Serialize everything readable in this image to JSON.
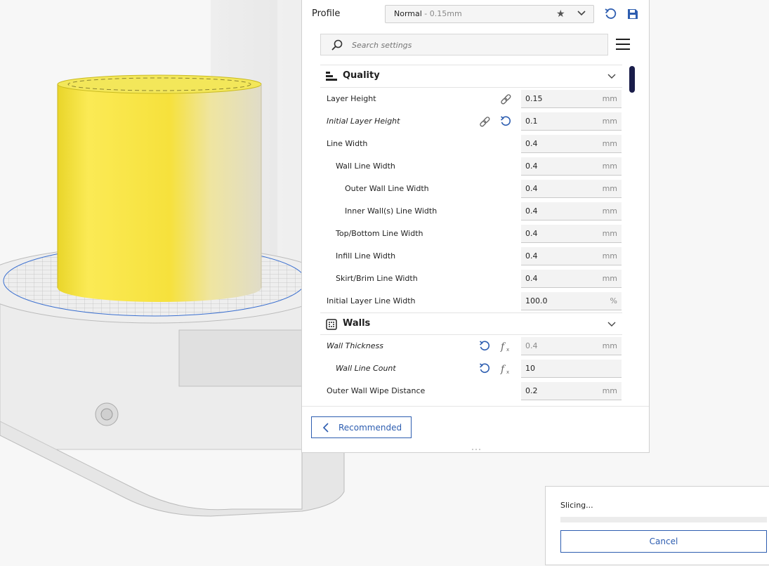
{
  "profile": {
    "label": "Profile",
    "selected_name": "Normal",
    "selected_layer": " - 0.15mm"
  },
  "search": {
    "placeholder": "Search settings"
  },
  "categories": {
    "quality": {
      "title": "Quality",
      "rows": [
        {
          "label": "Layer Height",
          "value": "0.15",
          "unit": "mm"
        },
        {
          "label": "Initial Layer Height",
          "value": "0.1",
          "unit": "mm"
        },
        {
          "label": "Line Width",
          "value": "0.4",
          "unit": "mm"
        },
        {
          "label": "Wall Line Width",
          "value": "0.4",
          "unit": "mm"
        },
        {
          "label": "Outer Wall Line Width",
          "value": "0.4",
          "unit": "mm"
        },
        {
          "label": "Inner Wall(s) Line Width",
          "value": "0.4",
          "unit": "mm"
        },
        {
          "label": "Top/Bottom Line Width",
          "value": "0.4",
          "unit": "mm"
        },
        {
          "label": "Infill Line Width",
          "value": "0.4",
          "unit": "mm"
        },
        {
          "label": "Skirt/Brim Line Width",
          "value": "0.4",
          "unit": "mm"
        },
        {
          "label": "Initial Layer Line Width",
          "value": "100.0",
          "unit": "%"
        }
      ]
    },
    "walls": {
      "title": "Walls",
      "rows": [
        {
          "label": "Wall Thickness",
          "value": "0.4",
          "unit": "mm"
        },
        {
          "label": "Wall Line Count",
          "value": "10",
          "unit": ""
        },
        {
          "label": "Outer Wall Wipe Distance",
          "value": "0.2",
          "unit": "mm"
        }
      ]
    }
  },
  "footer": {
    "recommended_label": "Recommended"
  },
  "slicing": {
    "status": "Slicing...",
    "progress": 0,
    "cancel_label": "Cancel"
  },
  "colors": {
    "accent": "#2d5db0",
    "scrollbar": "#1a1d4a",
    "model": "#f5e13a"
  }
}
